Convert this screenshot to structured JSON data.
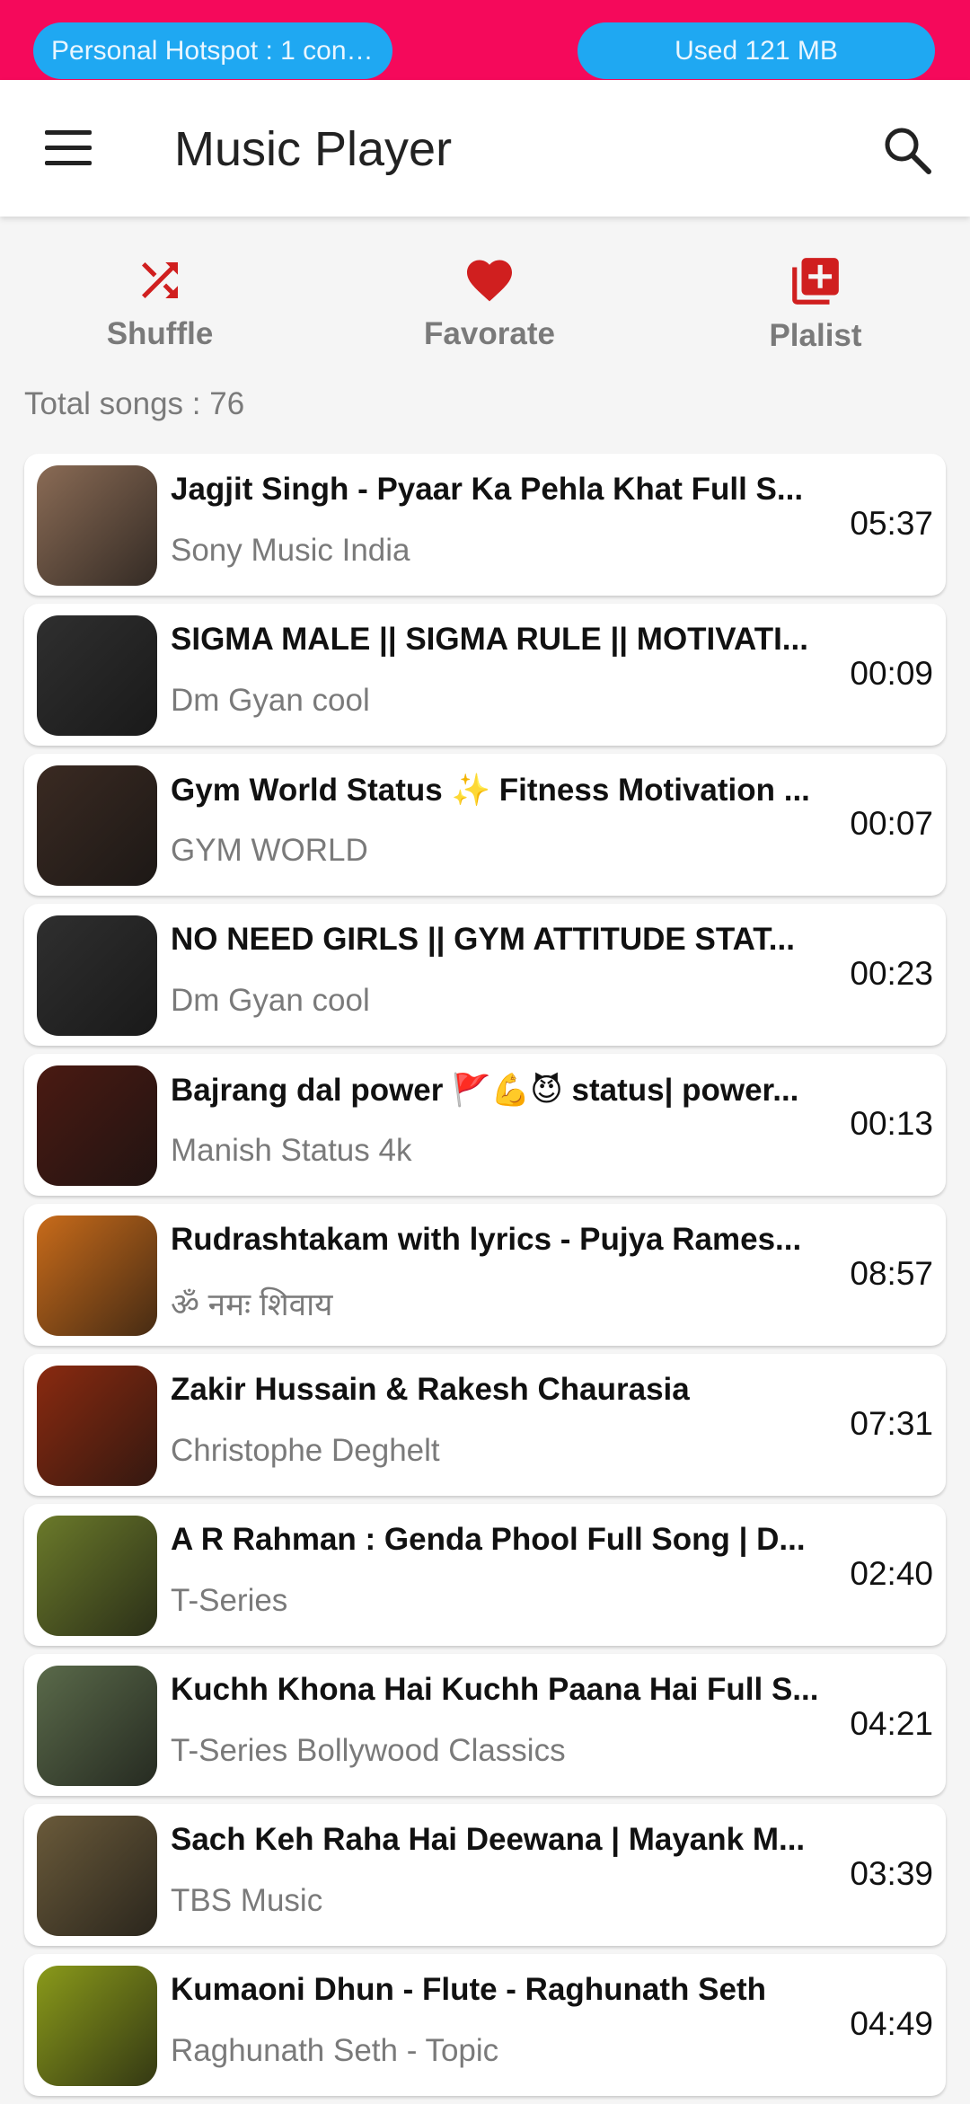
{
  "status_bar": {
    "hotspot": "Personal Hotspot : 1 conn...",
    "data_used": "Used  121 MB"
  },
  "app_bar": {
    "title": "Music Player",
    "menu_icon": "hamburger-menu-icon",
    "search_icon": "search-icon"
  },
  "actions": {
    "shuffle": {
      "label": "Shuffle",
      "icon": "shuffle-icon"
    },
    "favorite": {
      "label": "Favorate",
      "icon": "heart-icon"
    },
    "playlist": {
      "label": "Plalist",
      "icon": "playlist-add-icon"
    }
  },
  "total_songs": "Total songs : 76",
  "songs": [
    {
      "title": "Jagjit Singh - Pyaar Ka Pehla Khat Full S...",
      "artist": "Sony Music India",
      "duration": "05:37",
      "thumb": "#8a6b55"
    },
    {
      "title": "SIGMA MALE || SIGMA RULE || MOTIVATI...",
      "artist": "Dm Gyan cool",
      "duration": "00:09",
      "thumb": "#2f2f2f"
    },
    {
      "title": "Gym World Status ✨ Fitness Motivation ...",
      "artist": "GYM WORLD",
      "duration": "00:07",
      "thumb": "#3a2a22"
    },
    {
      "title": "NO NEED GIRLS  || GYM ATTITUDE STAT...",
      "artist": "Dm Gyan cool",
      "duration": "00:23",
      "thumb": "#2f2f2f"
    },
    {
      "title": "Bajrang dal power 🚩💪😈 status| power...",
      "artist": "Manish Status 4k",
      "duration": "00:13",
      "thumb": "#4a1a12"
    },
    {
      "title": "Rudrashtakam with lyrics - Pujya Rames...",
      "artist": "ॐ नमः शिवाय",
      "duration": "08:57",
      "thumb": "#c86b1a"
    },
    {
      "title": "Zakir Hussain & Rakesh Chaurasia",
      "artist": "Christophe Deghelt",
      "duration": "07:31",
      "thumb": "#8a2a10"
    },
    {
      "title": "A R Rahman : Genda Phool Full Song  | D...",
      "artist": "T-Series",
      "duration": "02:40",
      "thumb": "#6b7a2a"
    },
    {
      "title": "Kuchh Khona Hai Kuchh Paana Hai Full S...",
      "artist": "T-Series Bollywood Classics",
      "duration": "04:21",
      "thumb": "#5a6a4a"
    },
    {
      "title": "Sach Keh Raha Hai Deewana | Mayank M...",
      "artist": "TBS Music",
      "duration": "03:39",
      "thumb": "#6a5a3a"
    },
    {
      "title": "Kumaoni Dhun - Flute - Raghunath Seth",
      "artist": "Raghunath Seth - Topic",
      "duration": "04:49",
      "thumb": "#8a9a1a"
    }
  ],
  "colors": {
    "status_bar": "#f5095b",
    "pill": "#1fa8f2",
    "accent_red": "#d01f1f",
    "secondary_text": "#7a7a7a"
  }
}
